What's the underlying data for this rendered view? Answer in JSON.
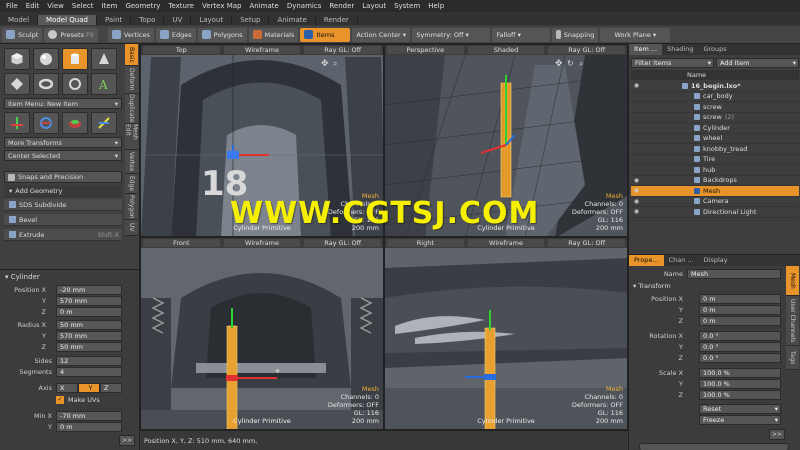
{
  "menu": [
    "File",
    "Edit",
    "View",
    "Select",
    "Item",
    "Geometry",
    "Texture",
    "Vertex Map",
    "Animate",
    "Dynamics",
    "Render",
    "Layout",
    "System",
    "Help"
  ],
  "layout_tabs": [
    {
      "label": "Model",
      "active": false
    },
    {
      "label": "Model Quad",
      "active": true
    },
    {
      "label": "Paint",
      "active": false
    },
    {
      "label": "Topo",
      "active": false
    },
    {
      "label": "UV",
      "active": false
    },
    {
      "label": "Layout",
      "active": false
    },
    {
      "label": "Setup",
      "active": false
    },
    {
      "label": "Animate",
      "active": false
    },
    {
      "label": "Render",
      "active": false
    }
  ],
  "toolbar": {
    "sculpt": "Sculpt",
    "presets": "Presets",
    "presets_key": "F6",
    "vertices": "Vertices",
    "edges": "Edges",
    "polygons": "Polygons",
    "materials": "Materials",
    "items": "Items",
    "action_center": "Action Center",
    "symmetry": "Symmetry: Off",
    "falloff": "Falloff",
    "snapping": "Snapping",
    "work_plane": "Work Plane"
  },
  "left_panel": {
    "item_menu": "Item Menu: New Item",
    "more_transforms": "More Transforms",
    "center_selected": "Center Selected",
    "snaps": "Snaps and Precision",
    "add_geometry": "Add Geometry",
    "sds_subdivide": "SDS Subdivide",
    "bevel": "Bevel",
    "extrude": "Extrude",
    "extrude_key": "Shift-X",
    "vtabs": [
      "Basic",
      "Deform",
      "Duplicate",
      "Mesh Edit",
      "Vertex",
      "Edge",
      "Polygon",
      "UV"
    ],
    "cylinder": {
      "title": "Cylinder",
      "position_label": "Position",
      "position": [
        "-20 mm",
        "570 mm",
        "0 m"
      ],
      "radius_label": "Radius",
      "radius": [
        "50 mm",
        "570 mm",
        "50 mm"
      ],
      "sides_label": "Sides",
      "sides": "12",
      "segments_label": "Segments",
      "segments": "4",
      "axis_label": "Axis",
      "axis": [
        "X",
        "Y",
        "Z"
      ],
      "make_uvs": "Make UVs",
      "minx_label": "Min X",
      "min": [
        "-70 mm",
        "0 m"
      ]
    }
  },
  "viewports": [
    {
      "name": "Top",
      "shading": "Wireframe",
      "raygl": "Ray GL: Off",
      "label": "Cylinder Primitive",
      "info": [
        "Mesh",
        "Channels: 0",
        "Deformers: OFF",
        "GL: 116",
        "200 mm"
      ]
    },
    {
      "name": "Perspective",
      "shading": "Shaded",
      "raygl": "Ray GL: Off",
      "label": "Cylinder Primitive",
      "info": [
        "Mesh",
        "Channels: 0",
        "Deformers: OFF",
        "GL: 116",
        "200 mm"
      ]
    },
    {
      "name": "Front",
      "shading": "Wireframe",
      "raygl": "Ray GL: Off",
      "label": "Cylinder Primitive",
      "info": [
        "Mesh",
        "Channels: 0",
        "Deformers: OFF",
        "GL: 116",
        "200 mm"
      ]
    },
    {
      "name": "Right",
      "shading": "Wireframe",
      "raygl": "Ray GL: Off",
      "label": "Cylinder Primitive",
      "info": [
        "Mesh",
        "Channels: 0",
        "Deformers: OFF",
        "GL: 116",
        "200 mm"
      ]
    }
  ],
  "top_number": "18",
  "watermark": "WWW.CGTSJ.COM",
  "status": "Position X, Y, Z:  510 mm, 640 mm,",
  "right_panel": {
    "tabs": [
      "Item ...",
      "Shading",
      "Groups"
    ],
    "filter": "Filter Items",
    "add_item": "Add Item",
    "name_col": "Name",
    "tree": [
      {
        "label": "16_begin.lxo*",
        "indent": 0,
        "sel": false,
        "bold": true
      },
      {
        "label": "car_body",
        "indent": 1,
        "sel": false
      },
      {
        "label": "screw",
        "indent": 1,
        "sel": false
      },
      {
        "label": "screw",
        "suffix": "(2)",
        "indent": 1,
        "sel": false
      },
      {
        "label": "Cylinder",
        "indent": 1,
        "sel": false
      },
      {
        "label": "wheel",
        "indent": 1,
        "sel": false
      },
      {
        "label": "knobby_tread",
        "indent": 1,
        "sel": false
      },
      {
        "label": "Tire",
        "indent": 1,
        "sel": false
      },
      {
        "label": "hub",
        "indent": 1,
        "sel": false
      },
      {
        "label": "Backdrops",
        "indent": 1,
        "sel": false
      },
      {
        "label": "Mesh",
        "indent": 1,
        "sel": true
      },
      {
        "label": "Camera",
        "indent": 1,
        "sel": false
      },
      {
        "label": "Directional Light",
        "indent": 1,
        "sel": false
      }
    ],
    "props_tabs": [
      "Prope...",
      "Chan ...",
      "Display"
    ],
    "side_tabs": [
      "Mesh",
      "User Channels",
      "Tags"
    ],
    "name_label": "Name",
    "name_value": "Mesh",
    "transform": "Transform",
    "position_label": "Position",
    "position": [
      "0 m",
      "0 m",
      "0 m"
    ],
    "rotation_label": "Rotation",
    "rotation": [
      "0.0 °",
      "0.0 °",
      "0.0 °"
    ],
    "scale_label": "Scale",
    "scale": [
      "100.0 %",
      "100.0 %",
      "100.0 %"
    ],
    "reset": "Reset",
    "freeze": "Freeze",
    "axes": [
      "X",
      "Y",
      "Z"
    ]
  }
}
